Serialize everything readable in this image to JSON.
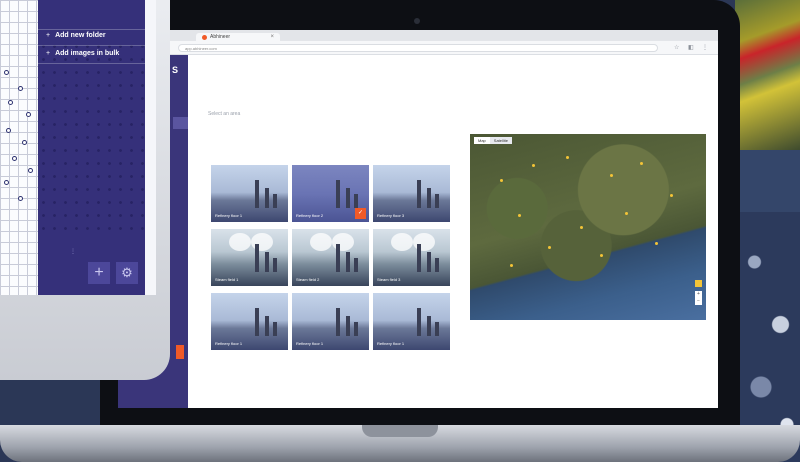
{
  "colors": {
    "brand_purple": "#35307a",
    "accent_orange": "#f05a28",
    "background_navy": "#2b3756"
  },
  "browser": {
    "tab_title": "Abhineer",
    "tab_close": "×",
    "url": "app.abhineer.com"
  },
  "side_panel": {
    "items": [
      {
        "icon": "plus-icon",
        "label": "Add new folder"
      },
      {
        "icon": "plus-icon",
        "label": "Add images in bulk"
      }
    ],
    "add_button_icon": "plus-icon",
    "settings_button_icon": "gear-icon"
  },
  "app": {
    "select_label": "Select an area",
    "thumbnails": [
      {
        "label": "Refinery floor 1",
        "style": "plain"
      },
      {
        "label": "Refinery floor 2",
        "style": "selected"
      },
      {
        "label": "Refinery floor 3",
        "style": "plain"
      },
      {
        "label": "Steam field 1",
        "style": "steam"
      },
      {
        "label": "Steam field 2",
        "style": "steam"
      },
      {
        "label": "Steam field 3",
        "style": "steam"
      },
      {
        "label": "Refinery floor 1",
        "style": "plain"
      },
      {
        "label": "Refinery floor 1",
        "style": "plain"
      },
      {
        "label": "Refinery floor 1",
        "style": "plain"
      }
    ],
    "map": {
      "toggle_options": [
        "Map",
        "Satellite"
      ],
      "active_toggle": "Satellite",
      "zoom_in": "+",
      "zoom_out": "−"
    }
  }
}
